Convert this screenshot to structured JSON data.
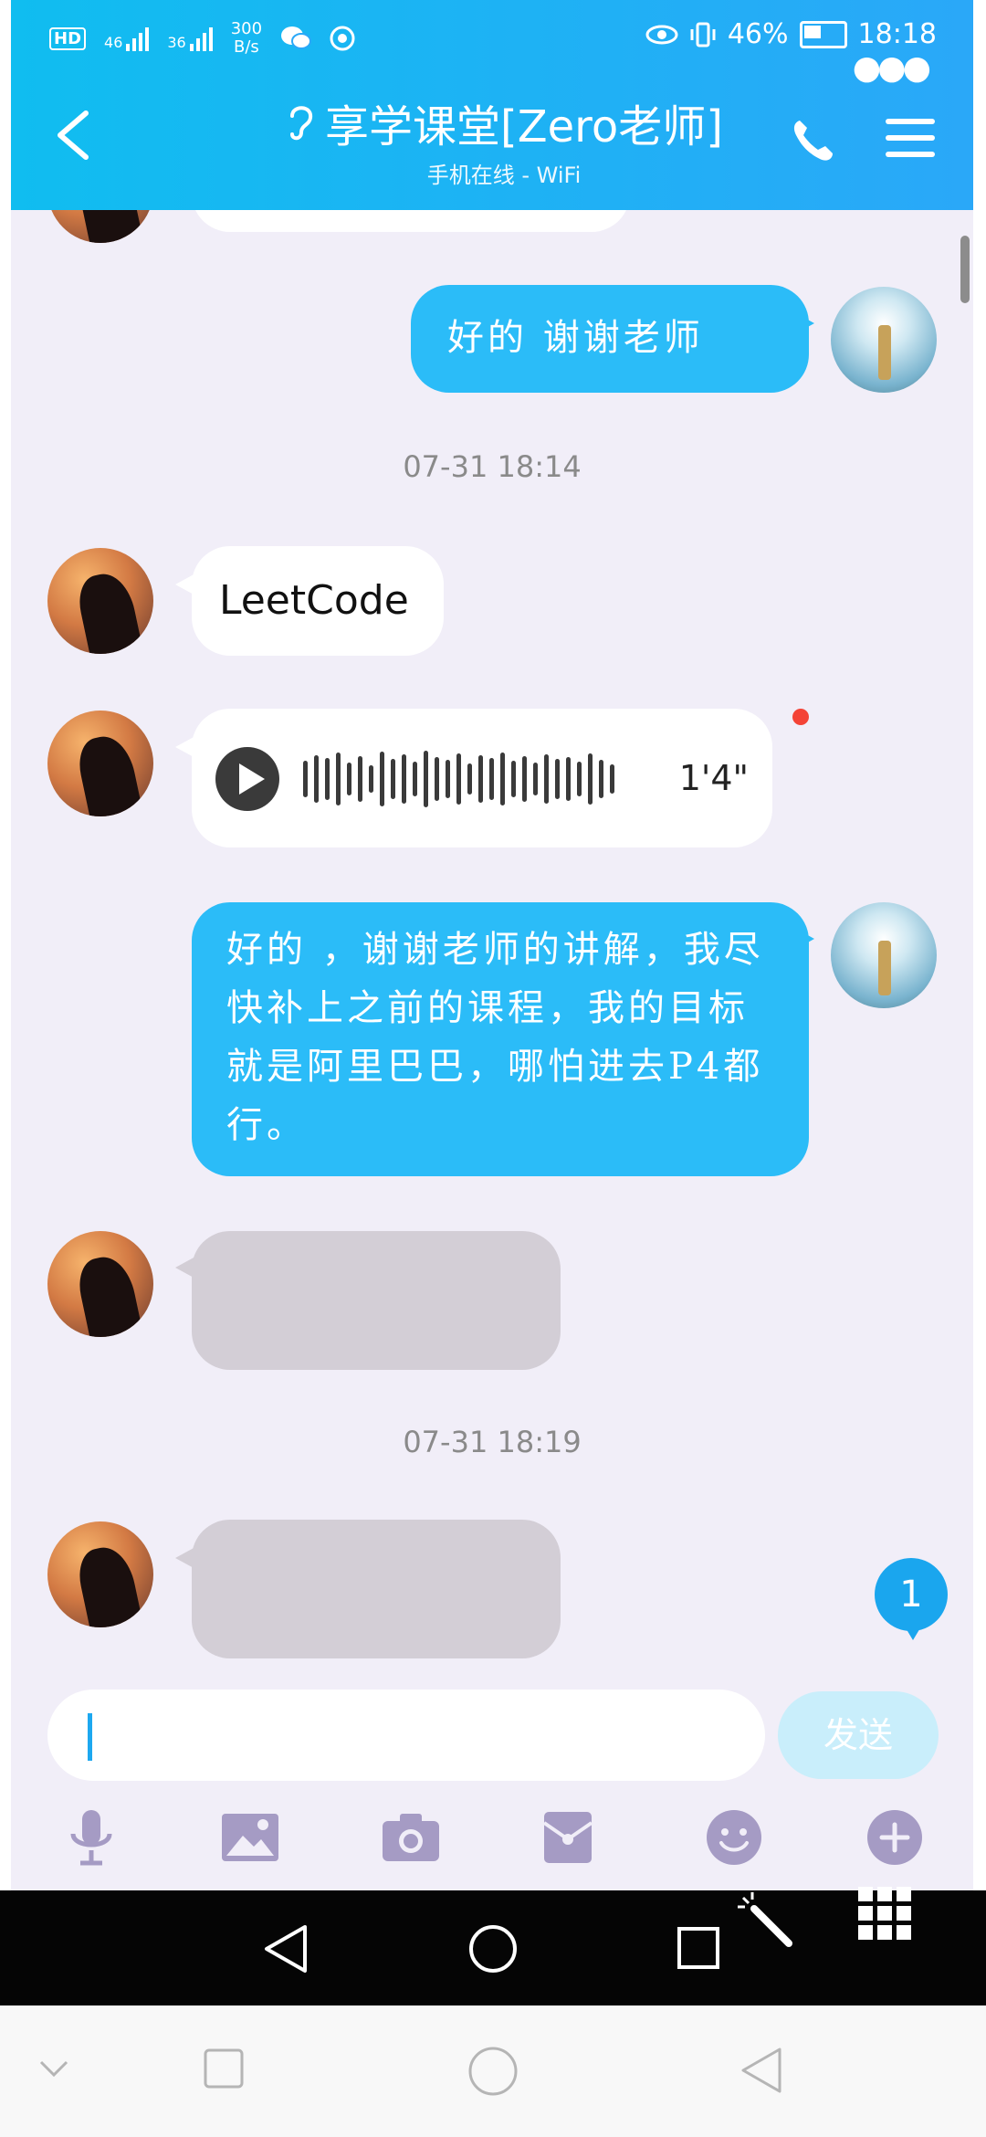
{
  "status_bar": {
    "hd": "HD",
    "sim1": "46",
    "sim2": "36",
    "speed_value": "300",
    "speed_unit": "B/s",
    "battery": "46%",
    "time": "18:18"
  },
  "header": {
    "title": "享学课堂[Zero老师]",
    "subtitle": "手机在线 - WiFi"
  },
  "messages": {
    "m0_text": "好的  谢谢老师",
    "time1": "07-31 18:14",
    "m1_text": "LeetCode",
    "m2_duration": "1'4\"",
    "m3_text": "好的 ，谢谢老师的讲解，我尽快补上之前的课程，我的目标就是阿里巴巴，哪怕进去P4都行。",
    "time2": "07-31 18:19"
  },
  "unread_count": "1",
  "input": {
    "value": "",
    "send_label": "发送"
  },
  "toolbar_icons": [
    "microphone-icon",
    "image-icon",
    "camera-icon",
    "red-packet-icon",
    "emoji-icon",
    "plus-icon"
  ],
  "colors": {
    "header_start": "#10bdf0",
    "header_end": "#2aa8f8",
    "outgoing_bubble": "#2bbcf8",
    "incoming_bubble": "#ffffff",
    "chat_background": "#f1eef8",
    "send_button": "#c9eefb"
  }
}
